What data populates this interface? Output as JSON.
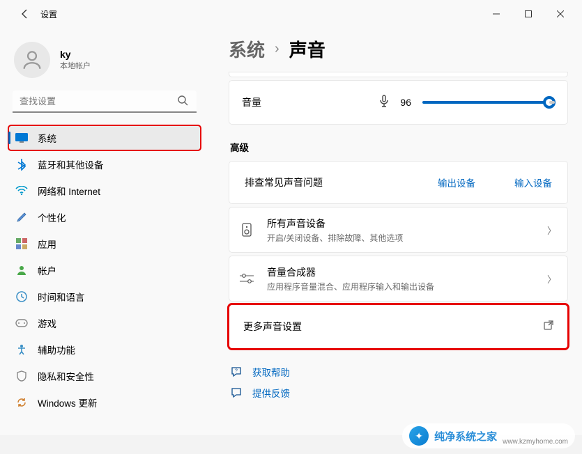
{
  "header": {
    "app_title": "设置"
  },
  "user": {
    "name": "ky",
    "subtitle": "本地帐户"
  },
  "search": {
    "placeholder": "查找设置"
  },
  "sidebar": {
    "items": [
      {
        "label": "系统",
        "icon": "system"
      },
      {
        "label": "蓝牙和其他设备",
        "icon": "bluetooth"
      },
      {
        "label": "网络和 Internet",
        "icon": "wifi"
      },
      {
        "label": "个性化",
        "icon": "personalize"
      },
      {
        "label": "应用",
        "icon": "apps"
      },
      {
        "label": "帐户",
        "icon": "account"
      },
      {
        "label": "时间和语言",
        "icon": "time"
      },
      {
        "label": "游戏",
        "icon": "gaming"
      },
      {
        "label": "辅助功能",
        "icon": "accessibility"
      },
      {
        "label": "隐私和安全性",
        "icon": "privacy"
      },
      {
        "label": "Windows 更新",
        "icon": "update"
      }
    ]
  },
  "breadcrumb": {
    "parent": "系统",
    "current": "声音"
  },
  "volume": {
    "label": "音量",
    "value": "96"
  },
  "section_advanced": "高级",
  "troubleshoot": {
    "label": "排查常见声音问题",
    "output_link": "输出设备",
    "input_link": "输入设备"
  },
  "all_devices": {
    "title": "所有声音设备",
    "subtitle": "开启/关闭设备、排除故障、其他选项"
  },
  "mixer": {
    "title": "音量合成器",
    "subtitle": "应用程序音量混合、应用程序输入和输出设备"
  },
  "more_sound": {
    "label": "更多声音设置"
  },
  "footer": {
    "help": "获取帮助",
    "feedback": "提供反馈"
  },
  "watermark": {
    "brand": "纯净系统之家",
    "url": "www.kzmyhome.com"
  }
}
